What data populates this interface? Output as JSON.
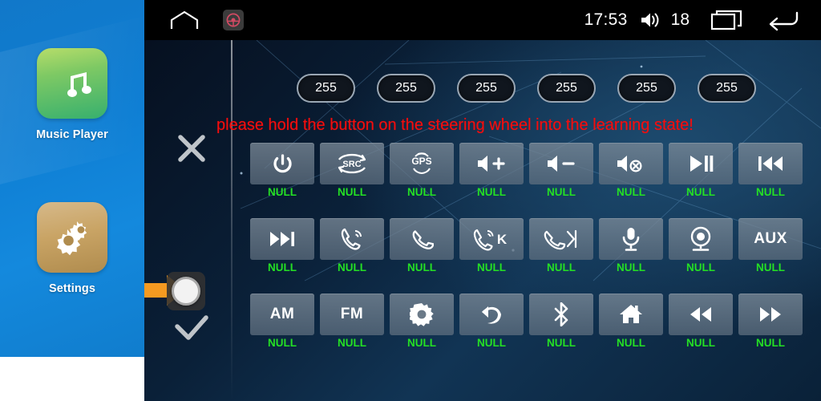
{
  "launcher": {
    "apps": [
      {
        "label": "Music Player",
        "icon": "music-note-icon"
      },
      {
        "label": "Settings",
        "icon": "gears-icon"
      }
    ]
  },
  "statusbar": {
    "home_icon": "home-outline-icon",
    "steering_icon": "steering-wheel-icon",
    "clock": "17:53",
    "volume_icon": "speaker-icon",
    "volume_level": "18",
    "recents_icon": "recents-icon",
    "back_icon": "back-arrow-icon"
  },
  "controls": {
    "cancel_icon": "close-x-icon",
    "confirm_icon": "check-icon",
    "cursor_icon": "touch-cursor-icon",
    "pointer_icon": "orange-arrow-icon"
  },
  "badges": [
    {
      "value": "255"
    },
    {
      "value": "255"
    },
    {
      "value": "255"
    },
    {
      "value": "255"
    },
    {
      "value": "255"
    },
    {
      "value": "255"
    }
  ],
  "message": "please hold the button on the steering wheel into the learning state!",
  "colors": {
    "message_red": "#f50d0d",
    "label_green": "#24e024",
    "key_gray": "#7b8a98",
    "launcher_blue": "#1178c9",
    "arrow_orange": "#f59a21"
  },
  "grid": {
    "rows": [
      [
        {
          "icon": "power-icon",
          "text": "",
          "label": "NULL"
        },
        {
          "icon": "src-icon",
          "text": "SRC",
          "label": "NULL"
        },
        {
          "icon": "gps-icon",
          "text": "GPS",
          "label": "NULL"
        },
        {
          "icon": "volume-up-icon",
          "text": "",
          "label": "NULL"
        },
        {
          "icon": "volume-down-icon",
          "text": "",
          "label": "NULL"
        },
        {
          "icon": "volume-mute-icon",
          "text": "",
          "label": "NULL"
        },
        {
          "icon": "play-pause-icon",
          "text": "",
          "label": "NULL"
        },
        {
          "icon": "previous-track-icon",
          "text": "",
          "label": "NULL"
        }
      ],
      [
        {
          "icon": "next-track-icon",
          "text": "",
          "label": "NULL"
        },
        {
          "icon": "phone-answer-icon",
          "text": "",
          "label": "NULL"
        },
        {
          "icon": "phone-hangup-icon",
          "text": "",
          "label": "NULL"
        },
        {
          "icon": "phone-answer-k-icon",
          "text": "K",
          "label": "NULL"
        },
        {
          "icon": "phone-hangup-arrow-icon",
          "text": "",
          "label": "NULL"
        },
        {
          "icon": "microphone-icon",
          "text": "",
          "label": "NULL"
        },
        {
          "icon": "camera-icon",
          "text": "",
          "label": "NULL"
        },
        {
          "icon": "aux-icon",
          "text": "AUX",
          "label": "NULL"
        }
      ],
      [
        {
          "icon": "am-icon",
          "text": "AM",
          "label": "NULL"
        },
        {
          "icon": "fm-icon",
          "text": "FM",
          "label": "NULL"
        },
        {
          "icon": "gear-icon",
          "text": "",
          "label": "NULL"
        },
        {
          "icon": "back-curve-icon",
          "text": "",
          "label": "NULL"
        },
        {
          "icon": "bluetooth-icon",
          "text": "",
          "label": "NULL"
        },
        {
          "icon": "home-icon",
          "text": "",
          "label": "NULL"
        },
        {
          "icon": "rewind-icon",
          "text": "",
          "label": "NULL"
        },
        {
          "icon": "fast-forward-icon",
          "text": "",
          "label": "NULL"
        }
      ]
    ]
  }
}
